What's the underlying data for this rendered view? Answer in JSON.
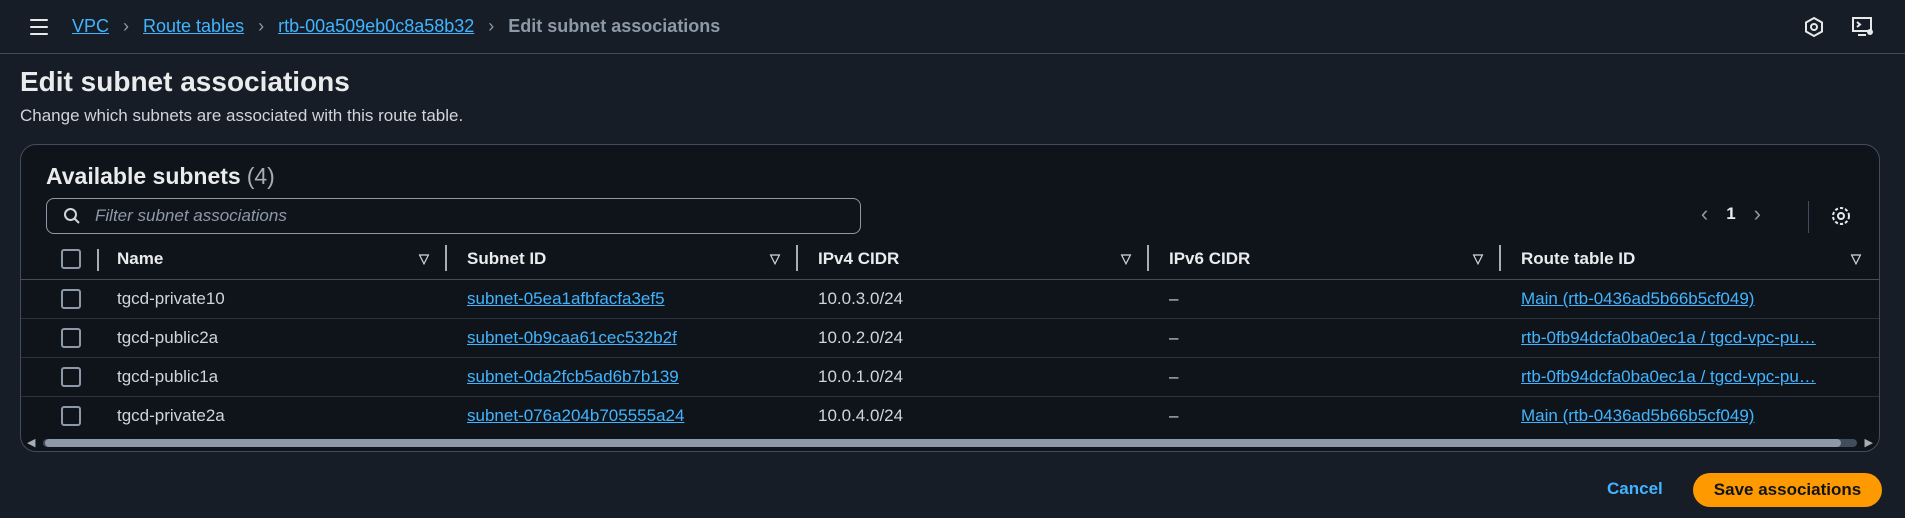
{
  "breadcrumb": {
    "items": [
      "VPC",
      "Route tables",
      "rtb-00a509eb0c8a58b32"
    ],
    "current": "Edit subnet associations"
  },
  "page": {
    "title": "Edit subnet associations",
    "description": "Change which subnets are associated with this route table."
  },
  "panel": {
    "title": "Available subnets",
    "count": "(4)",
    "search_placeholder": "Filter subnet associations",
    "page_number": "1"
  },
  "table": {
    "columns": [
      "Name",
      "Subnet ID",
      "IPv4 CIDR",
      "IPv6 CIDR",
      "Route table ID"
    ],
    "rows": [
      {
        "name": "tgcd-private10",
        "subnet_id": "subnet-05ea1afbfacfa3ef5",
        "ipv4": "10.0.3.0/24",
        "ipv6": "–",
        "route_table": "Main (rtb-0436ad5b66b5cf049)"
      },
      {
        "name": "tgcd-public2a",
        "subnet_id": "subnet-0b9caa61cec532b2f",
        "ipv4": "10.0.2.0/24",
        "ipv6": "–",
        "route_table": "rtb-0fb94dcfa0ba0ec1a / tgcd-vpc-pu…"
      },
      {
        "name": "tgcd-public1a",
        "subnet_id": "subnet-0da2fcb5ad6b7b139",
        "ipv4": "10.0.1.0/24",
        "ipv6": "–",
        "route_table": "rtb-0fb94dcfa0ba0ec1a / tgcd-vpc-pu…"
      },
      {
        "name": "tgcd-private2a",
        "subnet_id": "subnet-076a204b705555a24",
        "ipv4": "10.0.4.0/24",
        "ipv6": "–",
        "route_table": "Main (rtb-0436ad5b66b5cf049)"
      }
    ]
  },
  "actions": {
    "cancel": "Cancel",
    "save": "Save associations"
  },
  "colors": {
    "background": "#161d26",
    "link": "#42b4ff",
    "primary_button": "#ff9900"
  },
  "icons": [
    "menu-icon",
    "chevron-right-icon",
    "notifications-icon",
    "cloudshell-icon",
    "search-icon",
    "chevron-left-icon",
    "gear-icon",
    "filter-triangle-icon"
  ]
}
